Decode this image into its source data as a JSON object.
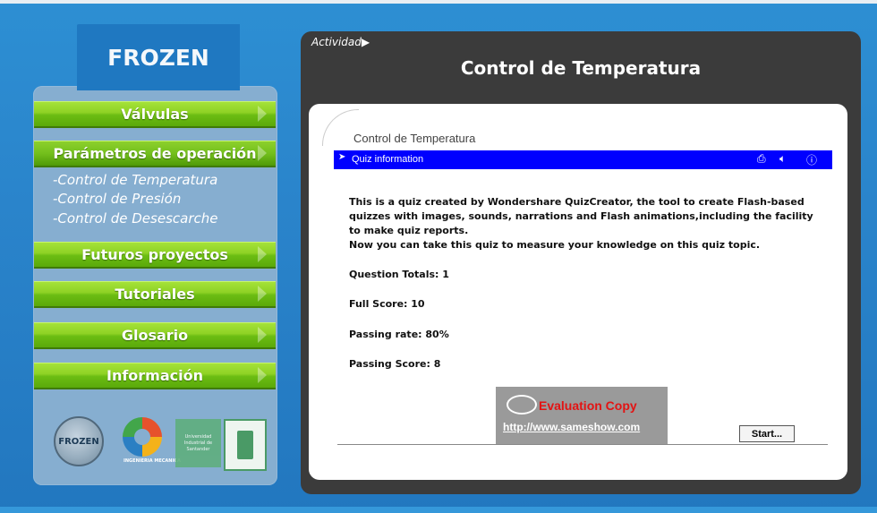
{
  "brand": {
    "logo_text": "FROZEN"
  },
  "menu": {
    "items": [
      {
        "label": "Válvulas"
      },
      {
        "label": "Parámetros de operación"
      },
      {
        "label": "Futuros proyectos"
      },
      {
        "label": "Tutoriales"
      },
      {
        "label": "Glosario"
      },
      {
        "label": "Información"
      }
    ],
    "sublinks": [
      "-Control de Temperatura",
      "-Control de Presión",
      "-Control de Desescarche"
    ]
  },
  "footer_logos": {
    "frozen": "FROZEN",
    "gear_caption": "INGENIERIA MECANICA",
    "uis_caption": "Universidad Industrial de Santander"
  },
  "header": {
    "breadcrumb": "Actividad",
    "title": "Control de Temperatura"
  },
  "quiz": {
    "title": "Control de Temperatura",
    "bar_label": "Quiz information",
    "intro": "This is a quiz created by Wondershare QuizCreator, the tool to create Flash-based quizzes with images, sounds, narrations and Flash animations,including the facility to make quiz reports.",
    "intro2": "Now you can take this quiz to measure your knowledge on this quiz topic.",
    "question_totals": "Question Totals: 1",
    "full_score": "Full Score: 10",
    "passing_rate": "Passing rate: 80%",
    "passing_score": "Passing Score: 8",
    "start_label": "Start..."
  },
  "watermark": {
    "title": "Evaluation Copy",
    "url": "http://www.sameshow.com"
  },
  "colors": {
    "background": "#2a84cb",
    "menu_green": "#8fd225",
    "panel": "#3b3b3b",
    "info_bar": "#0000ff"
  }
}
